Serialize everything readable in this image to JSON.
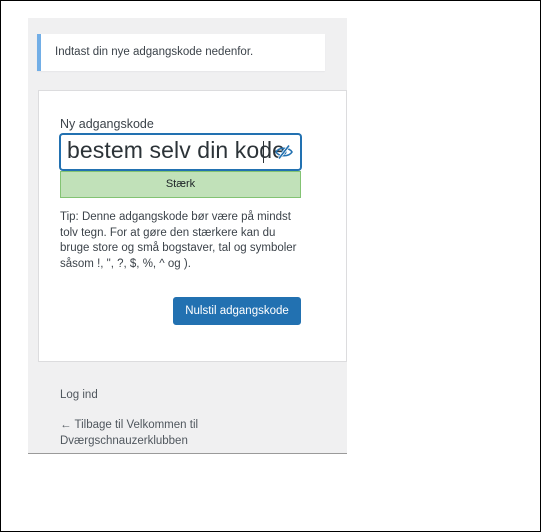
{
  "message": "Indtast din nye adgangskode nedenfor.",
  "form": {
    "password_label": "Ny adgangskode",
    "password_value": "bestem selv din kode",
    "strength_label": "Stærk",
    "tip": "Tip: Denne adgangskode bør være på mindst tolv tegn. For at gøre den stærkere kan du bruge store og små bogstaver, tal og symboler såsom !, \", ?, $, %, ^ og ).",
    "submit_label": "Nulstil adgangskode"
  },
  "nav": {
    "login_label": "Log ind",
    "back_label": "← Tilbage til Velkommen til Dværgschnauzerklubben"
  },
  "icons": {
    "toggle_visibility": "eye-slash-icon"
  },
  "colors": {
    "accent": "#2271b1",
    "info_border": "#72aee6",
    "strong_fill": "#c1e1b9",
    "strong_border": "#83c373",
    "panel_bg": "#f0f0f1"
  }
}
